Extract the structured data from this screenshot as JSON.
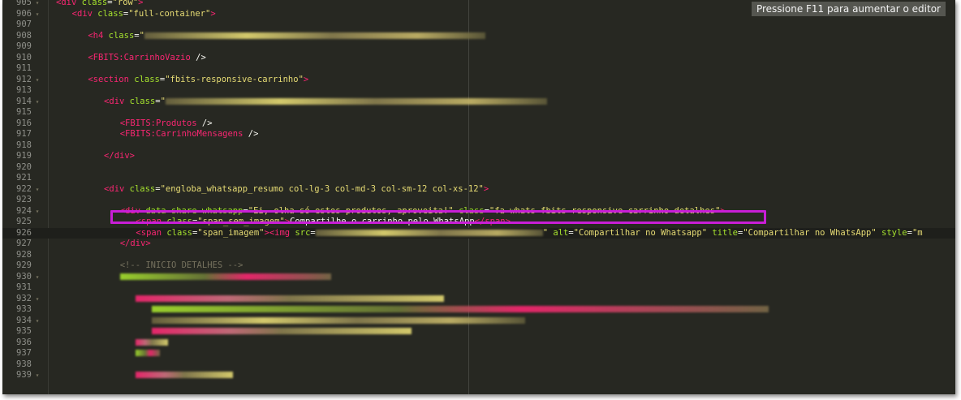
{
  "editor": {
    "hint": "Pressione F11 para aumentar o editor"
  },
  "lines": [
    {
      "n": "905",
      "fold": "▾",
      "indent": 0,
      "tokens": [
        [
          "t",
          "<div "
        ],
        [
          "a",
          "class"
        ],
        [
          "w",
          "="
        ],
        [
          "s",
          "\"row\""
        ],
        [
          "t",
          ">"
        ]
      ]
    },
    {
      "n": "906",
      "fold": "▾",
      "indent": 2,
      "tokens": [
        [
          "t",
          "<div "
        ],
        [
          "a",
          "class"
        ],
        [
          "w",
          "="
        ],
        [
          "s",
          "\"full-container\""
        ],
        [
          "t",
          ">"
        ]
      ]
    },
    {
      "n": "907",
      "fold": "",
      "indent": 0,
      "tokens": []
    },
    {
      "n": "908",
      "fold": "",
      "indent": 4,
      "tokens": [
        [
          "t",
          "<h4 "
        ],
        [
          "a",
          "class"
        ],
        [
          "w",
          "="
        ],
        [
          "s",
          "\""
        ]
      ],
      "blur": "b1",
      "blurw": 420
    },
    {
      "n": "909",
      "fold": "",
      "indent": 0,
      "tokens": []
    },
    {
      "n": "910",
      "fold": "",
      "indent": 4,
      "tokens": [
        [
          "t",
          "<FBITS:CarrinhoVazio "
        ],
        [
          "w",
          "/>"
        ]
      ]
    },
    {
      "n": "911",
      "fold": "",
      "indent": 0,
      "tokens": []
    },
    {
      "n": "912",
      "fold": "▾",
      "indent": 4,
      "tokens": [
        [
          "t",
          "<section "
        ],
        [
          "a",
          "class"
        ],
        [
          "w",
          "="
        ],
        [
          "s",
          "\"fbits-responsive-carrinho\""
        ],
        [
          "t",
          ">"
        ]
      ]
    },
    {
      "n": "913",
      "fold": "",
      "indent": 0,
      "tokens": []
    },
    {
      "n": "914",
      "fold": "▾",
      "indent": 6,
      "tokens": [
        [
          "t",
          "<div "
        ],
        [
          "a",
          "class"
        ],
        [
          "w",
          "="
        ],
        [
          "s",
          "\""
        ]
      ],
      "blur": "b1",
      "blurw": 470
    },
    {
      "n": "915",
      "fold": "",
      "indent": 0,
      "tokens": []
    },
    {
      "n": "916",
      "fold": "",
      "indent": 8,
      "tokens": [
        [
          "t",
          "<FBITS:Produtos "
        ],
        [
          "w",
          "/>"
        ]
      ]
    },
    {
      "n": "917",
      "fold": "",
      "indent": 8,
      "tokens": [
        [
          "t",
          "<FBITS:CarrinhoMensagens "
        ],
        [
          "w",
          "/>"
        ]
      ]
    },
    {
      "n": "918",
      "fold": "",
      "indent": 0,
      "tokens": []
    },
    {
      "n": "919",
      "fold": "",
      "indent": 6,
      "tokens": [
        [
          "t",
          "</div>"
        ]
      ]
    },
    {
      "n": "920",
      "fold": "",
      "indent": 0,
      "tokens": []
    },
    {
      "n": "921",
      "fold": "",
      "indent": 0,
      "tokens": []
    },
    {
      "n": "922",
      "fold": "▾",
      "indent": 6,
      "tokens": [
        [
          "t",
          "<div "
        ],
        [
          "a",
          "class"
        ],
        [
          "w",
          "="
        ],
        [
          "s",
          "\"engloba_whatsapp_resumo col-lg-3 col-md-3 col-sm-12 col-xs-12\""
        ],
        [
          "t",
          ">"
        ]
      ]
    },
    {
      "n": "923",
      "fold": "",
      "indent": 0,
      "tokens": []
    },
    {
      "n": "924",
      "fold": "▾",
      "indent": 8,
      "tokens": [
        [
          "t",
          "<div "
        ],
        [
          "a",
          "data-share-whatsapp"
        ],
        [
          "w",
          "="
        ],
        [
          "s",
          "\"Ei, olha só estes produtos, aproveita!\""
        ],
        [
          "w",
          " "
        ],
        [
          "a",
          "class"
        ],
        [
          "w",
          "="
        ],
        [
          "s",
          "\"fa-whats fbits-responsive-carrinho-detalhes\""
        ],
        [
          "t",
          ">"
        ]
      ]
    },
    {
      "n": "925",
      "fold": "",
      "indent": 10,
      "tokens": [
        [
          "t",
          "<span "
        ],
        [
          "a",
          "class"
        ],
        [
          "w",
          "="
        ],
        [
          "s",
          "\"span_sem_imagem\""
        ],
        [
          "t",
          ">"
        ],
        [
          "w",
          "Compartilhe o carrinho pelo WhatsApp"
        ],
        [
          "t",
          "</span>"
        ]
      ]
    },
    {
      "n": "926",
      "fold": "",
      "indent": 10,
      "active": true,
      "tokens": [
        [
          "t",
          "<span "
        ],
        [
          "a",
          "class"
        ],
        [
          "w",
          "="
        ],
        [
          "s",
          "\"span_imagem\""
        ],
        [
          "t",
          ">"
        ],
        [
          "t",
          "<img "
        ],
        [
          "a",
          "src"
        ],
        [
          "w",
          "="
        ]
      ],
      "blur": "b1",
      "blurw": 280,
      "after": [
        [
          "s",
          "\""
        ],
        [
          "w",
          " "
        ],
        [
          "a",
          "alt"
        ],
        [
          "w",
          "="
        ],
        [
          "s",
          "\"Compartilhar no Whatsapp\""
        ],
        [
          "w",
          " "
        ],
        [
          "a",
          "title"
        ],
        [
          "w",
          "="
        ],
        [
          "s",
          "\"Compartilhar no WhatsApp\""
        ],
        [
          "w",
          " "
        ],
        [
          "a",
          "style"
        ],
        [
          "w",
          "="
        ],
        [
          "s",
          "\"m"
        ]
      ]
    },
    {
      "n": "927",
      "fold": "",
      "indent": 8,
      "tokens": [
        [
          "t",
          "</div>"
        ]
      ]
    },
    {
      "n": "928",
      "fold": "",
      "indent": 0,
      "tokens": []
    },
    {
      "n": "929",
      "fold": "",
      "indent": 8,
      "tokens": [
        [
          "c",
          "<!-- INICIO DETALHES -->"
        ]
      ]
    },
    {
      "n": "930",
      "fold": "▾",
      "indent": 8,
      "tokens": [],
      "blur": "b2",
      "blurw": 260
    },
    {
      "n": "931",
      "fold": "",
      "indent": 0,
      "tokens": []
    },
    {
      "n": "932",
      "fold": "▾",
      "indent": 10,
      "tokens": [],
      "blur": "b3",
      "blurw": 380
    },
    {
      "n": "933",
      "fold": "",
      "indent": 12,
      "tokens": [],
      "blur": "b2",
      "blurw": 760
    },
    {
      "n": "934",
      "fold": "▾",
      "indent": 12,
      "tokens": [],
      "blur": "b1",
      "blurw": 460
    },
    {
      "n": "935",
      "fold": "",
      "indent": 12,
      "tokens": [],
      "blur": "b3",
      "blurw": 320
    },
    {
      "n": "936",
      "fold": "",
      "indent": 10,
      "tokens": [],
      "blur": "b3",
      "blurw": 40
    },
    {
      "n": "937",
      "fold": "",
      "indent": 10,
      "tokens": [],
      "blur": "b2",
      "blurw": 30
    },
    {
      "n": "938",
      "fold": "",
      "indent": 0,
      "tokens": []
    },
    {
      "n": "939",
      "fold": "▾",
      "indent": 10,
      "tokens": [],
      "blur": "b3",
      "blurw": 120
    }
  ]
}
